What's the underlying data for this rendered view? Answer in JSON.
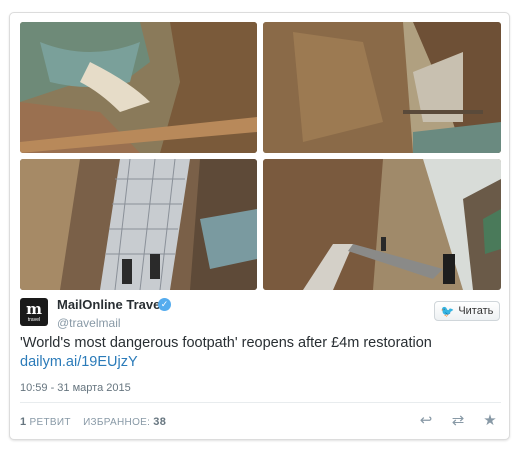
{
  "account": {
    "name": "MailOnline Travel",
    "handle": "@travelmail",
    "avatar_letter": "m",
    "avatar_sub": "travel",
    "verified_icon": "check-icon",
    "verified_color": "#55acee"
  },
  "follow_button": {
    "label": "Читать",
    "icon": "twitter-bird-icon"
  },
  "tweet": {
    "text": "'World's most dangerous footpath' reopens after £4m restoration",
    "link": "dailym.ai/19EUjzY",
    "link_color": "#2b7bb9"
  },
  "timestamp": "10:59 - 31 марта 2015",
  "stats": {
    "retweets_count": "1",
    "retweets_label": "РЕТВИТ",
    "favorites_label": "ИЗБРАННОЕ:",
    "favorites_count": "38"
  },
  "actions": [
    "reply-icon",
    "retweet-icon",
    "favorite-icon"
  ]
}
